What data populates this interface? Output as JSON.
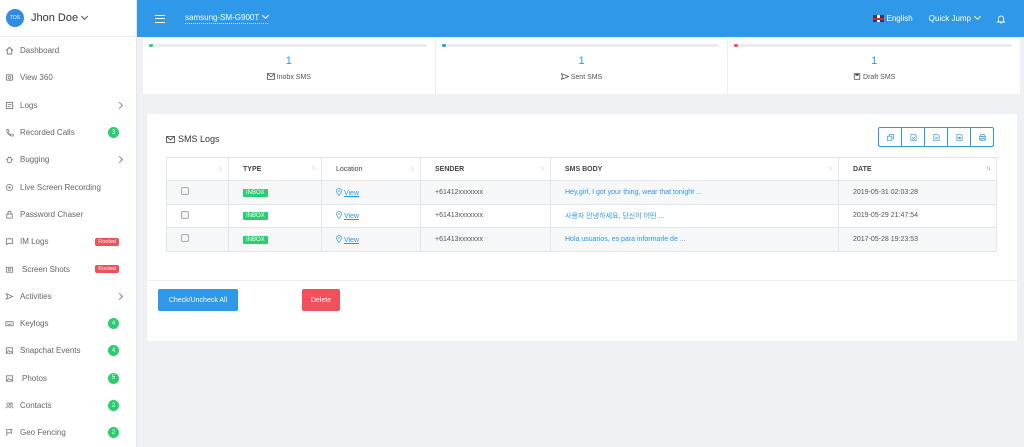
{
  "profile": {
    "initials": "TOS",
    "name": "Jhon Doe"
  },
  "sidebar": {
    "items": [
      {
        "label": "Dashboard",
        "icon": "home-icon"
      },
      {
        "label": "View 360",
        "icon": "view-360-icon"
      },
      {
        "label": "Logs",
        "icon": "logs-icon",
        "has_submenu": true
      },
      {
        "label": "Recorded Calls",
        "icon": "phone-icon",
        "badge": "3"
      },
      {
        "label": "Bugging",
        "icon": "bug-icon",
        "has_submenu": true
      },
      {
        "label": "Live Screen Recording",
        "icon": "record-icon"
      },
      {
        "label": "Password Chaser",
        "icon": "lock-icon"
      },
      {
        "label": "IM Logs",
        "icon": "chat-icon",
        "tag": "Rooted"
      },
      {
        "label": "Screen Shots",
        "icon": "screenshot-icon",
        "tag": "Rooted"
      },
      {
        "label": "Activities",
        "icon": "send-icon",
        "has_submenu": true
      },
      {
        "label": "Keylogs",
        "icon": "keyboard-icon",
        "badge": "4"
      },
      {
        "label": "Snapchat Events",
        "icon": "image-icon",
        "badge": "4"
      },
      {
        "label": "Photos",
        "icon": "photo-icon",
        "badge": "5"
      },
      {
        "label": "Contacts",
        "icon": "contacts-icon",
        "badge": "2"
      },
      {
        "label": "Geo Fencing",
        "icon": "flag-icon",
        "badge": "2"
      }
    ]
  },
  "topbar": {
    "device": "samsung-SM-G900T",
    "language": "English",
    "quick_jump": "Quick Jump"
  },
  "stats": [
    {
      "value": "1",
      "label": "Inobx SMS",
      "icon": "envelope-icon",
      "color": "#2ecc71"
    },
    {
      "value": "1",
      "label": "Sent SMS",
      "icon": "send-icon",
      "color": "#2f98e9"
    },
    {
      "value": "1",
      "label": "Draft SMS",
      "icon": "save-icon",
      "color": "#f0505a"
    }
  ],
  "card": {
    "title": "SMS Logs"
  },
  "table": {
    "columns": [
      "",
      "TYPE",
      "Location",
      "SENDER",
      "SMS BODY",
      "DATE"
    ],
    "rows": [
      {
        "type": "INBOX",
        "location": "View",
        "sender": "+61412xxxxxxx",
        "body": "Hey,girl, I got your thing, wear that tonight ...",
        "date": "2019-05-31 02:03:28"
      },
      {
        "type": "INBOX",
        "location": "View",
        "sender": "+61413xxxxxxx",
        "body": "사용자 안녕하세요, 당신이 어떤 ...",
        "date": "2019-05-29 21:47:54"
      },
      {
        "type": "INBOX",
        "location": "View",
        "sender": "+61413xxxxxxx",
        "body": "Hola usuarios, es para informarle de ...",
        "date": "2017-05-28 19:23:53"
      }
    ]
  },
  "actions": {
    "check_all": "Check/Uncheck All",
    "delete": "Delete"
  }
}
